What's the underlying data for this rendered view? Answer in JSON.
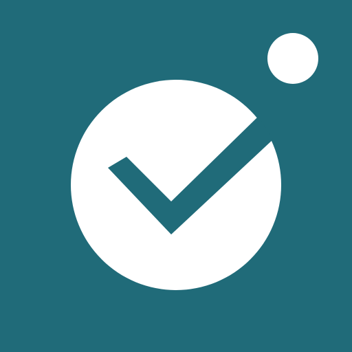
{
  "icon": {
    "name": "check-circle-with-dot",
    "background_color": "#206b79",
    "foreground_color": "#ffffff",
    "checkmark_color": "#206b79"
  }
}
